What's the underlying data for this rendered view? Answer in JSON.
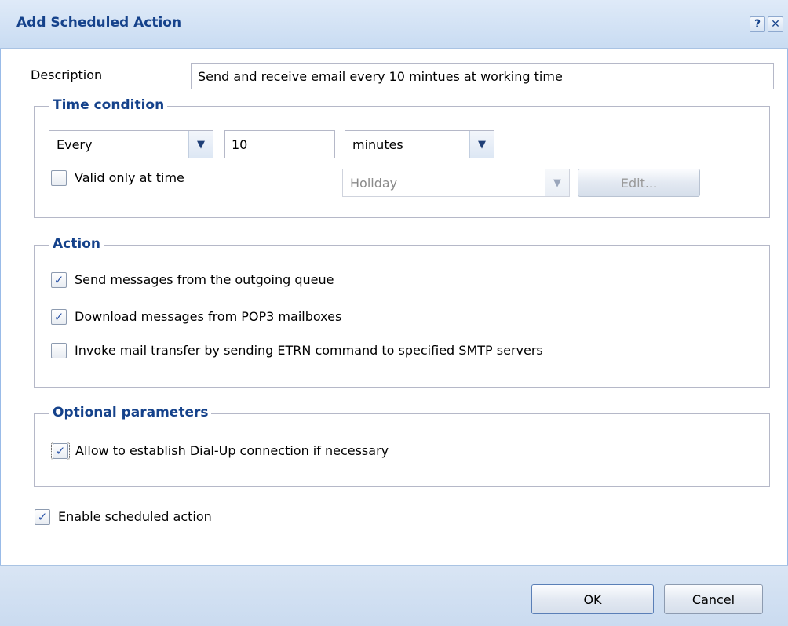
{
  "window": {
    "title": "Add Scheduled Action",
    "help_label": "?",
    "close_label": "✕"
  },
  "description": {
    "label": "Description",
    "value": "Send and receive email every 10 mintues at working time"
  },
  "time_condition": {
    "legend": "Time condition",
    "frequency": "Every",
    "interval": "10",
    "unit": "minutes",
    "valid_only_label": "Valid only at time",
    "valid_only_checked": false,
    "schedule": "Holiday",
    "edit_label": "Edit..."
  },
  "action": {
    "legend": "Action",
    "items": [
      {
        "label": "Send messages from the outgoing queue",
        "checked": true
      },
      {
        "label": "Download messages from POP3 mailboxes",
        "checked": true
      },
      {
        "label": "Invoke mail transfer by sending ETRN command to specified SMTP servers",
        "checked": false
      }
    ]
  },
  "optional": {
    "legend": "Optional parameters",
    "dialup_label": "Allow to establish Dial-Up connection if necessary",
    "dialup_checked": true
  },
  "enable": {
    "label": "Enable scheduled action",
    "checked": true
  },
  "buttons": {
    "ok": "OK",
    "cancel": "Cancel"
  },
  "icons": {
    "check": "✓",
    "dropdown": "▼"
  }
}
